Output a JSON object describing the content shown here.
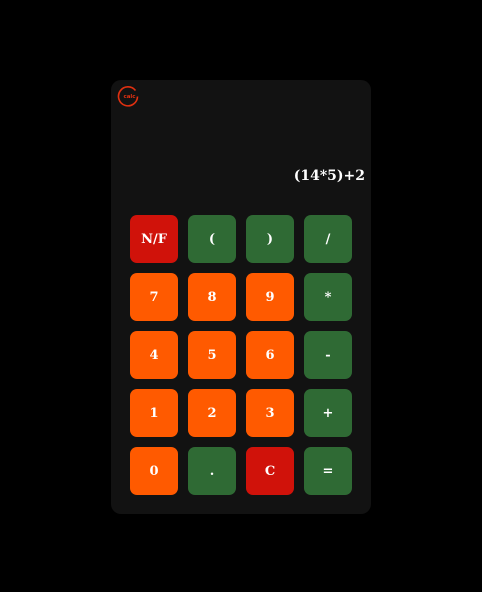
{
  "colors": {
    "background": "#000000",
    "panel": "#121212",
    "orange": "#ff5a00",
    "green": "#2f6a34",
    "red": "#d0120a",
    "logo": "#e03010"
  },
  "logo": {
    "icon": "calculator-logo-icon",
    "text": "calc"
  },
  "display": {
    "expression": "(14*5)+2"
  },
  "keys": [
    {
      "label": "N/F",
      "color": "red",
      "name": "key-nf"
    },
    {
      "label": "(",
      "color": "green",
      "name": "key-open-paren"
    },
    {
      "label": ")",
      "color": "green",
      "name": "key-close-paren"
    },
    {
      "label": "/",
      "color": "green",
      "name": "key-divide"
    },
    {
      "label": "7",
      "color": "orange",
      "name": "key-7"
    },
    {
      "label": "8",
      "color": "orange",
      "name": "key-8"
    },
    {
      "label": "9",
      "color": "orange",
      "name": "key-9"
    },
    {
      "label": "*",
      "color": "green",
      "name": "key-multiply"
    },
    {
      "label": "4",
      "color": "orange",
      "name": "key-4"
    },
    {
      "label": "5",
      "color": "orange",
      "name": "key-5"
    },
    {
      "label": "6",
      "color": "orange",
      "name": "key-6"
    },
    {
      "label": "-",
      "color": "green",
      "name": "key-subtract"
    },
    {
      "label": "1",
      "color": "orange",
      "name": "key-1"
    },
    {
      "label": "2",
      "color": "orange",
      "name": "key-2"
    },
    {
      "label": "3",
      "color": "orange",
      "name": "key-3"
    },
    {
      "label": "+",
      "color": "green",
      "name": "key-add"
    },
    {
      "label": "0",
      "color": "orange",
      "name": "key-0"
    },
    {
      "label": ".",
      "color": "green",
      "name": "key-decimal"
    },
    {
      "label": "C",
      "color": "red",
      "name": "key-clear"
    },
    {
      "label": "=",
      "color": "green",
      "name": "key-equals"
    }
  ]
}
